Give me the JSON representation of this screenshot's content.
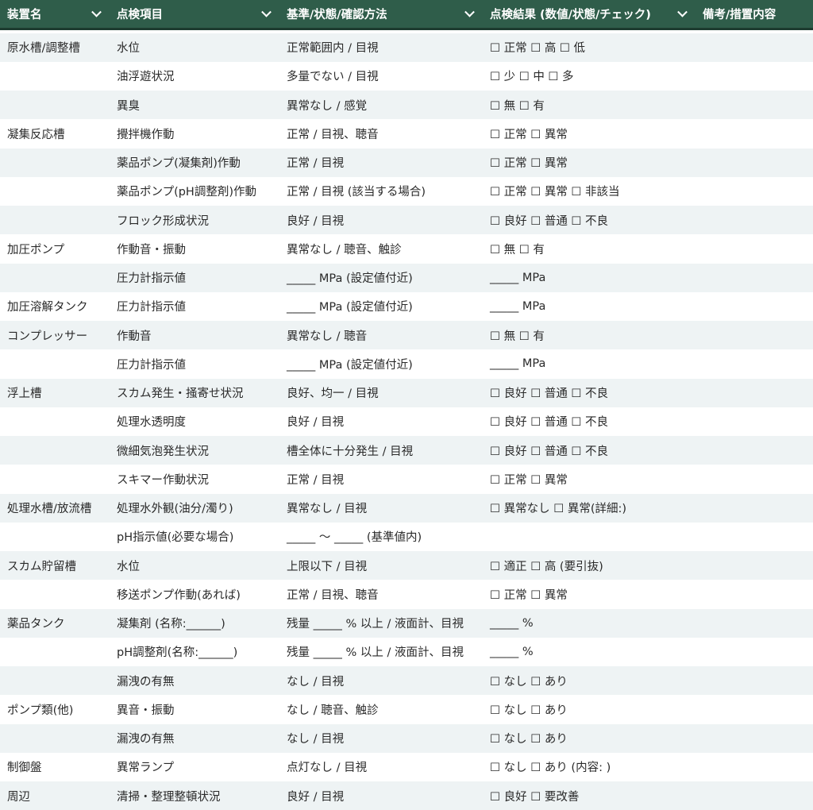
{
  "headers": [
    "装置名",
    "点検項目",
    "基準/状態/確認方法",
    "点検結果 (数値/状態/チェック)",
    "備考/措置内容"
  ],
  "rows": [
    [
      "原水槽/調整槽",
      "水位",
      "正常範囲内 / 目視",
      "☐ 正常 ☐ 高 ☐ 低",
      ""
    ],
    [
      "",
      "油浮遊状況",
      "多量でない / 目視",
      "☐ 少 ☐ 中 ☐ 多",
      ""
    ],
    [
      "",
      "異臭",
      "異常なし / 感覚",
      "☐ 無 ☐ 有",
      ""
    ],
    [
      "凝集反応槽",
      "攪拌機作動",
      "正常 / 目視、聴音",
      "☐ 正常 ☐ 異常",
      ""
    ],
    [
      "",
      "薬品ポンプ(凝集剤)作動",
      "正常 / 目視",
      "☐ 正常 ☐ 異常",
      ""
    ],
    [
      "",
      "薬品ポンプ(pH調整剤)作動",
      "正常 / 目視 (該当する場合)",
      "☐ 正常 ☐ 異常 ☐ 非該当",
      ""
    ],
    [
      "",
      "フロック形成状況",
      "良好 / 目視",
      "☐ 良好 ☐ 普通 ☐ 不良",
      ""
    ],
    [
      "加圧ポンプ",
      "作動音・振動",
      "異常なし / 聴音、触診",
      "☐ 無 ☐ 有",
      ""
    ],
    [
      "",
      "圧力計指示値",
      "_____ MPa (設定値付近)",
      "_____ MPa",
      ""
    ],
    [
      "加圧溶解タンク",
      "圧力計指示値",
      "_____ MPa (設定値付近)",
      "_____ MPa",
      ""
    ],
    [
      "コンプレッサー",
      "作動音",
      "異常なし / 聴音",
      "☐ 無 ☐ 有",
      ""
    ],
    [
      "",
      "圧力計指示値",
      "_____ MPa (設定値付近)",
      "_____ MPa",
      ""
    ],
    [
      "浮上槽",
      "スカム発生・掻寄せ状況",
      "良好、均一 / 目視",
      "☐ 良好 ☐ 普通 ☐ 不良",
      ""
    ],
    [
      "",
      "処理水透明度",
      "良好 / 目視",
      "☐ 良好 ☐ 普通 ☐ 不良",
      ""
    ],
    [
      "",
      "微細気泡発生状況",
      "槽全体に十分発生 / 目視",
      "☐ 良好 ☐ 普通 ☐ 不良",
      ""
    ],
    [
      "",
      "スキマー作動状況",
      "正常 / 目視",
      "☐ 正常 ☐ 異常",
      ""
    ],
    [
      "処理水槽/放流槽",
      "処理水外観(油分/濁り)",
      "異常なし / 目視",
      "☐ 異常なし ☐ 異常(詳細:)",
      ""
    ],
    [
      "",
      "pH指示値(必要な場合)",
      "_____ ～ _____ (基準値内)",
      "",
      ""
    ],
    [
      "スカム貯留槽",
      "水位",
      "上限以下 / 目視",
      "☐ 適正 ☐ 高 (要引抜)",
      ""
    ],
    [
      "",
      "移送ポンプ作動(あれば)",
      "正常 / 目視、聴音",
      "☐ 正常 ☐ 異常",
      ""
    ],
    [
      "薬品タンク",
      "凝集剤 (名称:______)",
      "残量 _____ % 以上 / 液面計、目視",
      "_____ %",
      ""
    ],
    [
      "",
      "pH調整剤(名称:______)",
      "残量 _____ % 以上 / 液面計、目視",
      "_____ %",
      ""
    ],
    [
      "",
      "漏洩の有無",
      "なし / 目視",
      "☐ なし ☐ あり",
      ""
    ],
    [
      "ポンプ類(他)",
      "異音・振動",
      "なし / 聴音、触診",
      "☐ なし ☐ あり",
      ""
    ],
    [
      "",
      "漏洩の有無",
      "なし / 目視",
      "☐ なし ☐ あり",
      ""
    ],
    [
      "制御盤",
      "異常ランプ",
      "点灯なし / 目視",
      "☐ なし ☐ あり (内容: )",
      ""
    ],
    [
      "周辺",
      "清掃・整理整頓状況",
      "良好 / 目視",
      "☐ 良好 ☐ 要改善",
      ""
    ]
  ]
}
